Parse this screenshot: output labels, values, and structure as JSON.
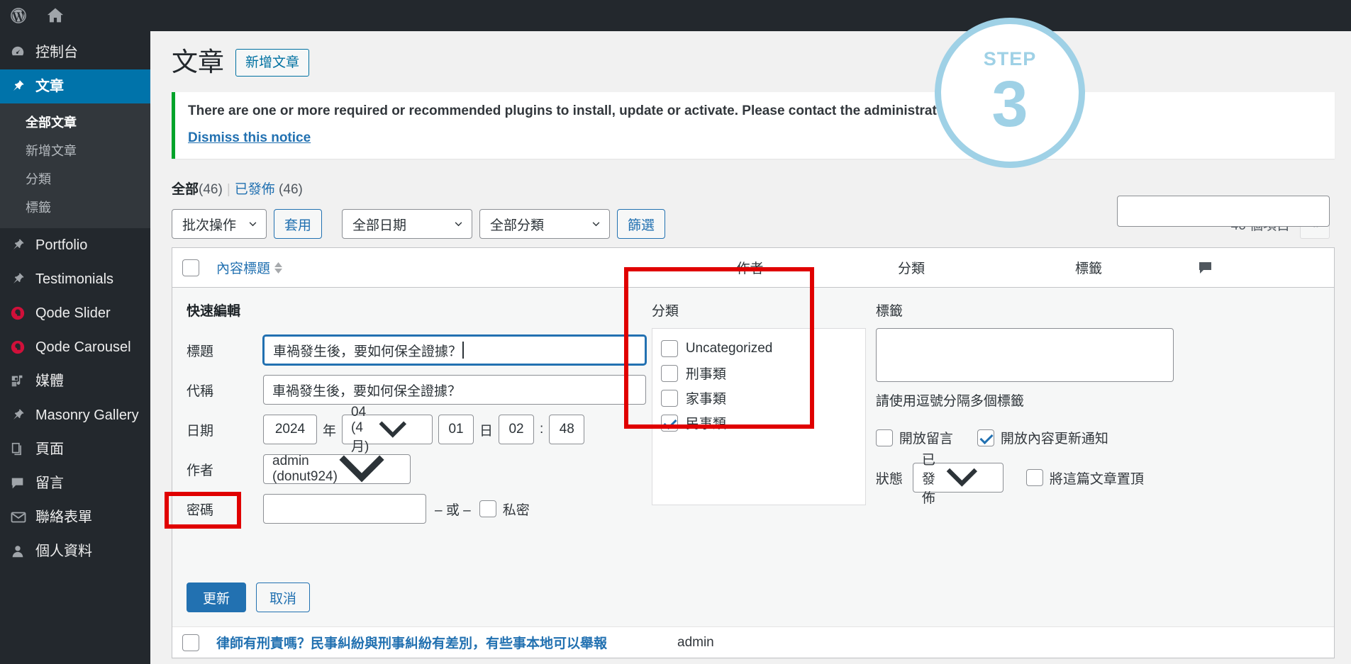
{
  "adminbar": {
    "wp_logo": "wordpress-logo-icon",
    "site_home": "home-icon"
  },
  "sidebar": {
    "items": [
      {
        "label": "控制台",
        "icon": "dashboard-icon",
        "current": false
      },
      {
        "label": "文章",
        "icon": "pin-icon",
        "current": true
      },
      {
        "label": "Portfolio",
        "icon": "pin-icon",
        "current": false
      },
      {
        "label": "Testimonials",
        "icon": "pin-icon",
        "current": false
      },
      {
        "label": "Qode Slider",
        "icon": "qode-icon",
        "current": false
      },
      {
        "label": "Qode Carousel",
        "icon": "qode-icon",
        "current": false
      },
      {
        "label": "媒體",
        "icon": "media-icon",
        "current": false
      },
      {
        "label": "Masonry Gallery",
        "icon": "pin-icon",
        "current": false
      },
      {
        "label": "頁面",
        "icon": "pages-icon",
        "current": false
      },
      {
        "label": "留言",
        "icon": "comment-icon",
        "current": false
      },
      {
        "label": "聯絡表單",
        "icon": "mail-icon",
        "current": false
      },
      {
        "label": "個人資料",
        "icon": "user-icon",
        "current": false
      }
    ],
    "submenu": [
      {
        "label": "全部文章",
        "current": true
      },
      {
        "label": "新增文章",
        "current": false
      },
      {
        "label": "分類",
        "current": false
      },
      {
        "label": "標籤",
        "current": false
      }
    ]
  },
  "header": {
    "title": "文章",
    "add_new_label": "新增文章"
  },
  "notice": {
    "message": "There are one or more required or recommended plugins to install, update or activate. Please contact the administrator of this",
    "dismiss_label": "Dismiss this notice",
    "accent_color": "#00a32a"
  },
  "status_links": {
    "all_label": "全部",
    "all_count": "(46)",
    "separator": "|",
    "published_label": "已發佈",
    "published_count": "(46)"
  },
  "tablenav": {
    "bulk_action": "批次操作",
    "apply_label": "套用",
    "date_filter": "全部日期",
    "category_filter": "全部分類",
    "filter_label": "篩選",
    "displaying_num": "46 個項目",
    "first_page_label": "«"
  },
  "table": {
    "columns": {
      "title": "內容標題",
      "author": "作者",
      "categories": "分類",
      "tags": "標籤",
      "comments": "comment-bubble-icon"
    }
  },
  "quick_edit": {
    "heading": "快速編輯",
    "fields": {
      "title_label": "標題",
      "title_value": "車禍發生後，要如何保全證據？",
      "slug_label": "代稱",
      "slug_value": "車禍發生後，要如何保全證據？",
      "date_label": "日期",
      "date_year": "2024",
      "date_year_unit": "年",
      "date_month": "04 (4 月)",
      "date_day": "01",
      "date_day_unit": "日",
      "date_hour": "02",
      "date_time_sep": ":",
      "date_minute": "48",
      "author_label": "作者",
      "author_value": "admin (donut924)",
      "password_label": "密碼",
      "password_value": "",
      "or_text": "– 或 –",
      "private_label": "私密",
      "private_checked": false
    },
    "categories": {
      "label": "分類",
      "items": [
        {
          "label": "Uncategorized",
          "checked": false
        },
        {
          "label": "刑事類",
          "checked": false
        },
        {
          "label": "家事類",
          "checked": false
        },
        {
          "label": "民事類",
          "checked": true
        }
      ]
    },
    "tags": {
      "label": "標籤",
      "value": "",
      "hint": "請使用逗號分隔多個標籤"
    },
    "options": [
      {
        "label": "開放留言",
        "checked": false
      },
      {
        "label": "開放內容更新通知",
        "checked": true
      }
    ],
    "status": {
      "label": "狀態",
      "value": "已發佈",
      "sticky_label": "將這篇文章置頂",
      "sticky_checked": false
    },
    "submit": {
      "update_label": "更新",
      "cancel_label": "取消"
    }
  },
  "next_row": {
    "title": "律師有刑責嗎？民事糾紛與刑事糾紛有差別，有些事本地可以舉報",
    "author": "admin"
  },
  "step_badge": {
    "word": "STEP",
    "number": "3",
    "color": "#9fd1e6"
  },
  "annotations": {
    "category_box_color": "#e00000",
    "update_button_color": "#e00000"
  }
}
